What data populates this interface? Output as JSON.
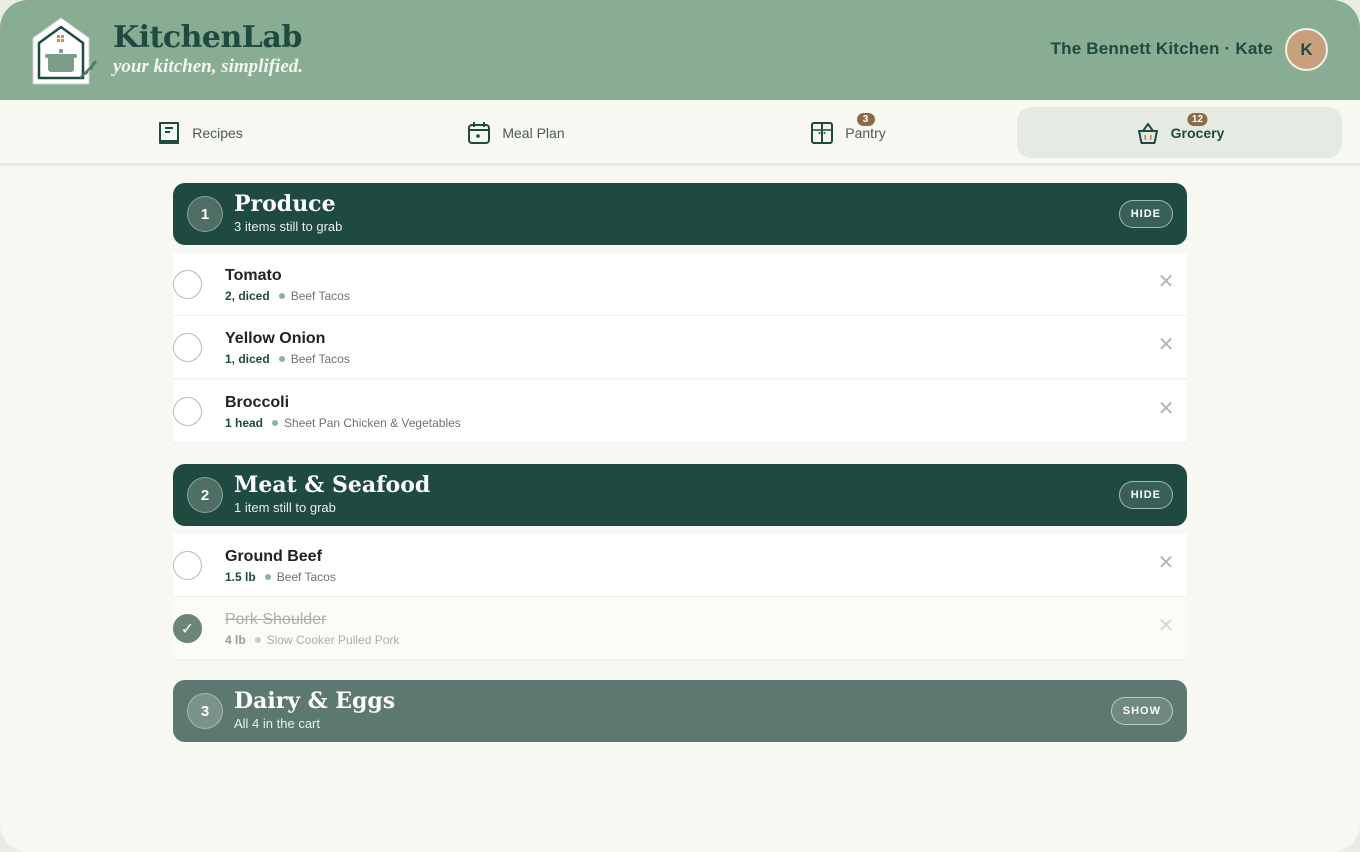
{
  "header": {
    "brand": "KitchenLab",
    "tagline": "your kitchen, simplified.",
    "household": "The Bennett Kitchen · Kate",
    "avatar_initial": "K"
  },
  "nav": {
    "tabs": [
      {
        "label": "Recipes",
        "icon": "recipe-book-icon"
      },
      {
        "label": "Meal Plan",
        "icon": "calendar-icon"
      },
      {
        "label": "Pantry",
        "icon": "pantry-cabinet-icon",
        "badge": "3"
      },
      {
        "label": "Grocery",
        "icon": "basket-icon",
        "badge": "12",
        "active": true
      }
    ]
  },
  "sections": [
    {
      "number": "1",
      "title": "Produce",
      "subtitle": "3 items still to grab",
      "toggle": "HIDE",
      "items": [
        {
          "name": "Tomato",
          "qty": "2, diced",
          "recipe": "Beef Tacos",
          "checked": false
        },
        {
          "name": "Yellow Onion",
          "qty": "1, diced",
          "recipe": "Beef Tacos",
          "checked": false
        },
        {
          "name": "Broccoli",
          "qty": "1 head",
          "recipe": "Sheet Pan Chicken & Vegetables",
          "checked": false
        }
      ]
    },
    {
      "number": "2",
      "title": "Meat & Seafood",
      "subtitle": "1 item still to grab",
      "toggle": "HIDE",
      "items": [
        {
          "name": "Ground Beef",
          "qty": "1.5 lb",
          "recipe": "Beef Tacos",
          "checked": false
        },
        {
          "name": "Pork Shoulder",
          "qty": "4 lb",
          "recipe": "Slow Cooker Pulled Pork",
          "checked": true
        }
      ]
    },
    {
      "number": "3",
      "title": "Dairy & Eggs",
      "subtitle": "All 4 in the cart",
      "toggle": "SHOW",
      "items": []
    }
  ],
  "icons": {
    "check": "✓",
    "remove": "✕"
  },
  "colors": {
    "header": "#89ad93",
    "primary": "#1e4a40",
    "badge": "#8c6a48",
    "muted_section": "#5c7870"
  }
}
